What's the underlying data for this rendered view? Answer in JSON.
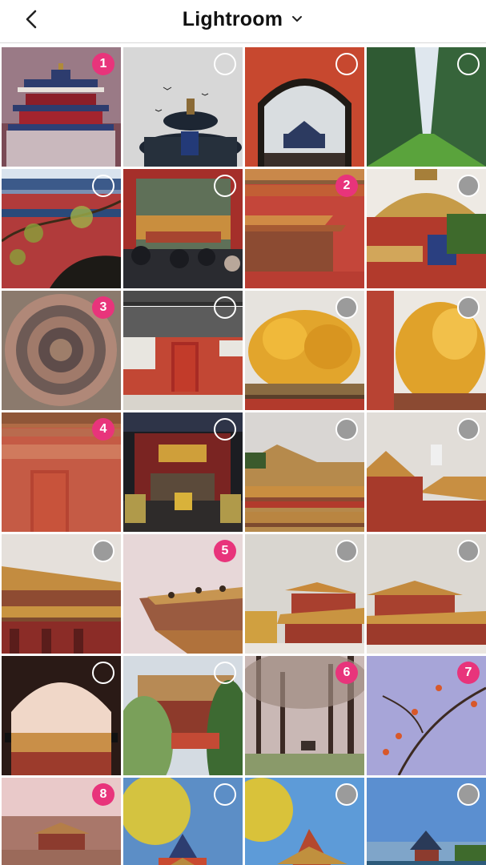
{
  "header": {
    "title": "Lightroom"
  },
  "tiles": [
    {
      "scene": "temple",
      "state": "num",
      "n": "1"
    },
    {
      "scene": "templesky",
      "state": "empty"
    },
    {
      "scene": "arch",
      "state": "empty"
    },
    {
      "scene": "avenue",
      "state": "empty"
    },
    {
      "scene": "branchwall",
      "state": "empty"
    },
    {
      "scene": "gatecrowd",
      "state": "empty"
    },
    {
      "scene": "eaves",
      "state": "num",
      "n": "2"
    },
    {
      "scene": "pavilion",
      "state": "grey"
    },
    {
      "scene": "ceiling",
      "state": "num",
      "n": "3"
    },
    {
      "scene": "wallgate",
      "state": "empty"
    },
    {
      "scene": "ginkgo",
      "state": "grey"
    },
    {
      "scene": "ginkgo2",
      "state": "grey"
    },
    {
      "scene": "reddoor",
      "state": "num",
      "n": "4"
    },
    {
      "scene": "hall",
      "state": "empty"
    },
    {
      "scene": "roofs",
      "state": "grey"
    },
    {
      "scene": "roofs2",
      "state": "grey"
    },
    {
      "scene": "longhall",
      "state": "grey"
    },
    {
      "scene": "ridge",
      "state": "num",
      "n": "5"
    },
    {
      "scene": "tower",
      "state": "grey"
    },
    {
      "scene": "tower2",
      "state": "grey"
    },
    {
      "scene": "archway",
      "state": "empty"
    },
    {
      "scene": "willow",
      "state": "empty"
    },
    {
      "scene": "trees",
      "state": "num",
      "n": "6"
    },
    {
      "scene": "persimmon",
      "state": "num",
      "n": "7"
    },
    {
      "scene": "city",
      "state": "num",
      "n": "8"
    },
    {
      "scene": "corner",
      "state": "empty"
    },
    {
      "scene": "corner2",
      "state": "grey"
    },
    {
      "scene": "moat",
      "state": "grey"
    }
  ]
}
